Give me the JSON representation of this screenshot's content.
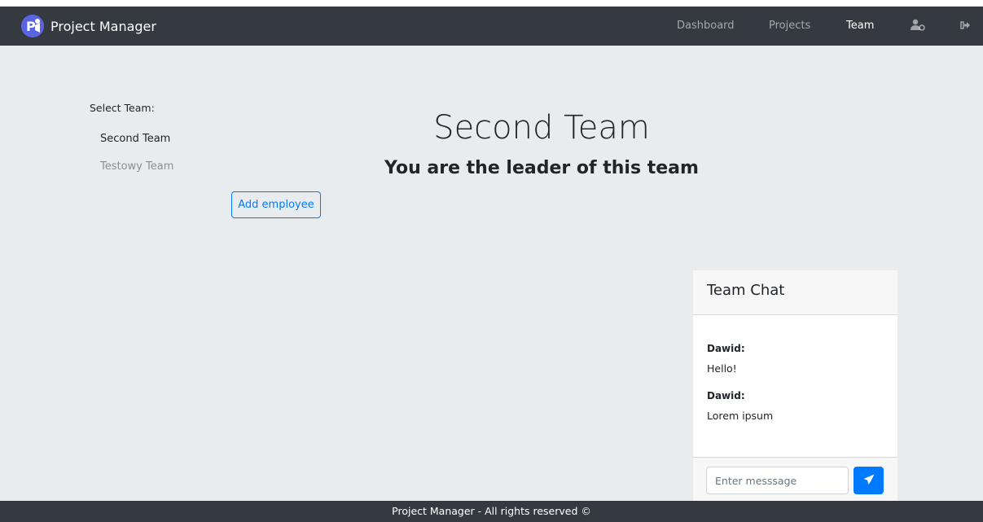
{
  "app": {
    "brand_name": "Project Manager",
    "logo_text": "P"
  },
  "nav": {
    "links": [
      {
        "label": "Dashboard",
        "active": false
      },
      {
        "label": "Projects",
        "active": false
      },
      {
        "label": "Team",
        "active": true
      }
    ],
    "icons": [
      "user-settings-icon",
      "sign-out-icon"
    ]
  },
  "sidebar": {
    "label": "Select Team:",
    "teams": [
      {
        "name": "Second Team",
        "selected": true
      },
      {
        "name": "Testowy Team",
        "selected": false
      }
    ]
  },
  "main": {
    "team_title": "Second Team",
    "team_subtitle": "You are the leader of this team",
    "add_button_label": "Add employee"
  },
  "chat": {
    "title": "Team Chat",
    "messages": [
      {
        "author": "Dawid:",
        "text": "Hello!"
      },
      {
        "author": "Dawid:",
        "text": "Lorem ipsum"
      }
    ],
    "input_placeholder": "Enter messsage",
    "send_icon": "paper-plane-icon"
  },
  "footer": {
    "text": "Project Manager - All rights reserved ©"
  },
  "colors": {
    "navbar": "#343a40",
    "background": "#e9ecef",
    "primary": "#007bff"
  }
}
